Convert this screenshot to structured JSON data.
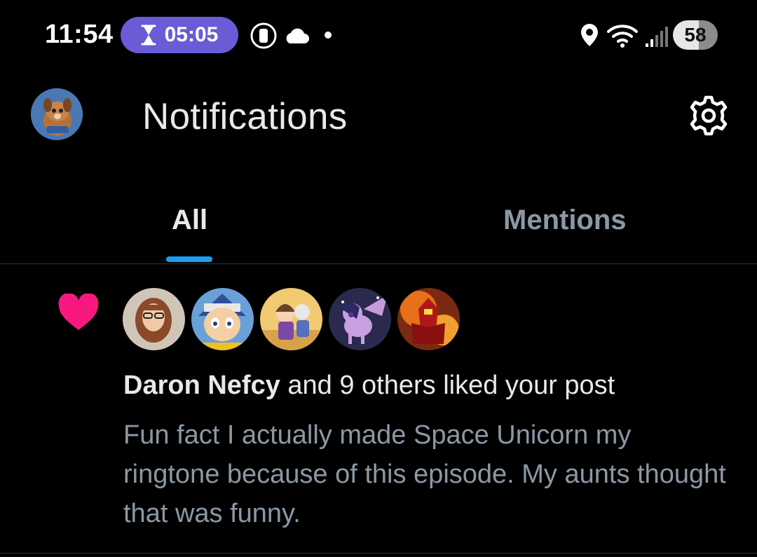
{
  "status_bar": {
    "time": "11:54",
    "timer": "05:05",
    "battery": "58",
    "icons": [
      "hourglass-icon",
      "screen-record-icon",
      "cloud-icon",
      "dot-icon",
      "location-icon",
      "wifi-icon",
      "signal-icon",
      "battery-icon"
    ]
  },
  "header": {
    "title": "Notifications",
    "avatar_icon": "profile-avatar",
    "settings_icon": "gear-icon"
  },
  "tabs": [
    {
      "label": "All",
      "active": true
    },
    {
      "label": "Mentions",
      "active": false
    }
  ],
  "colors": {
    "background": "#000000",
    "accent": "#1d9bf0",
    "like": "#f91880",
    "primary_text": "#e7e9ea",
    "secondary_text": "#8b98a5",
    "timer_pill": "#6a5bd6"
  },
  "notification": {
    "type": "like",
    "icon": "heart-icon",
    "actor": "Daron Nefcy",
    "action": " and 9 others liked your post",
    "post_snippet": "Fun fact I actually made Space Unicorn my ringtone because of this episode. My aunts thought that was funny."
  }
}
